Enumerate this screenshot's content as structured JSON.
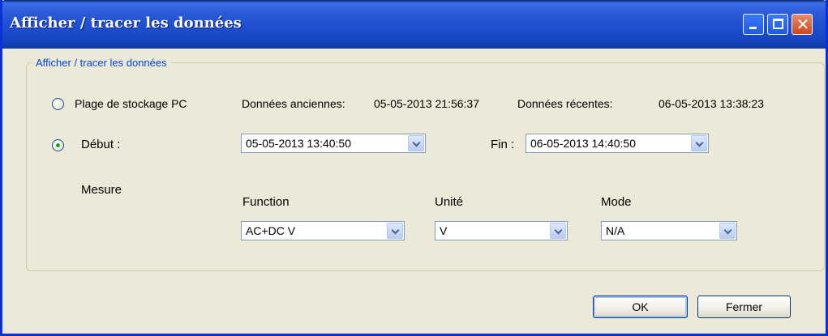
{
  "window": {
    "title": "Afficher / tracer les données",
    "controls": {
      "minimize_icon": "minimize-icon",
      "maximize_icon": "maximize-icon",
      "close_icon": "close-icon",
      "close_glyph": "✕"
    }
  },
  "group": {
    "legend": "Afficher / tracer les données",
    "range": {
      "radio_label": "Plage de stockage PC",
      "selected": false,
      "oldest_label": "Données anciennes:",
      "oldest_value": "05-05-2013 21:56:37",
      "recent_label": "Données récentes:",
      "recent_value": "06-05-2013 13:38:23"
    },
    "custom": {
      "radio_label": "Début :",
      "selected": true,
      "start_value": "05-05-2013 13:40:50",
      "end_label": "Fin :",
      "end_value": "06-05-2013 14:40:50"
    },
    "measure": {
      "label": "Mesure",
      "function_label": "Function",
      "function_value": "AC+DC V",
      "unit_label": "Unité",
      "unit_value": "V",
      "mode_label": "Mode",
      "mode_value": "N/A"
    }
  },
  "buttons": {
    "ok": "OK",
    "close": "Fermer"
  }
}
